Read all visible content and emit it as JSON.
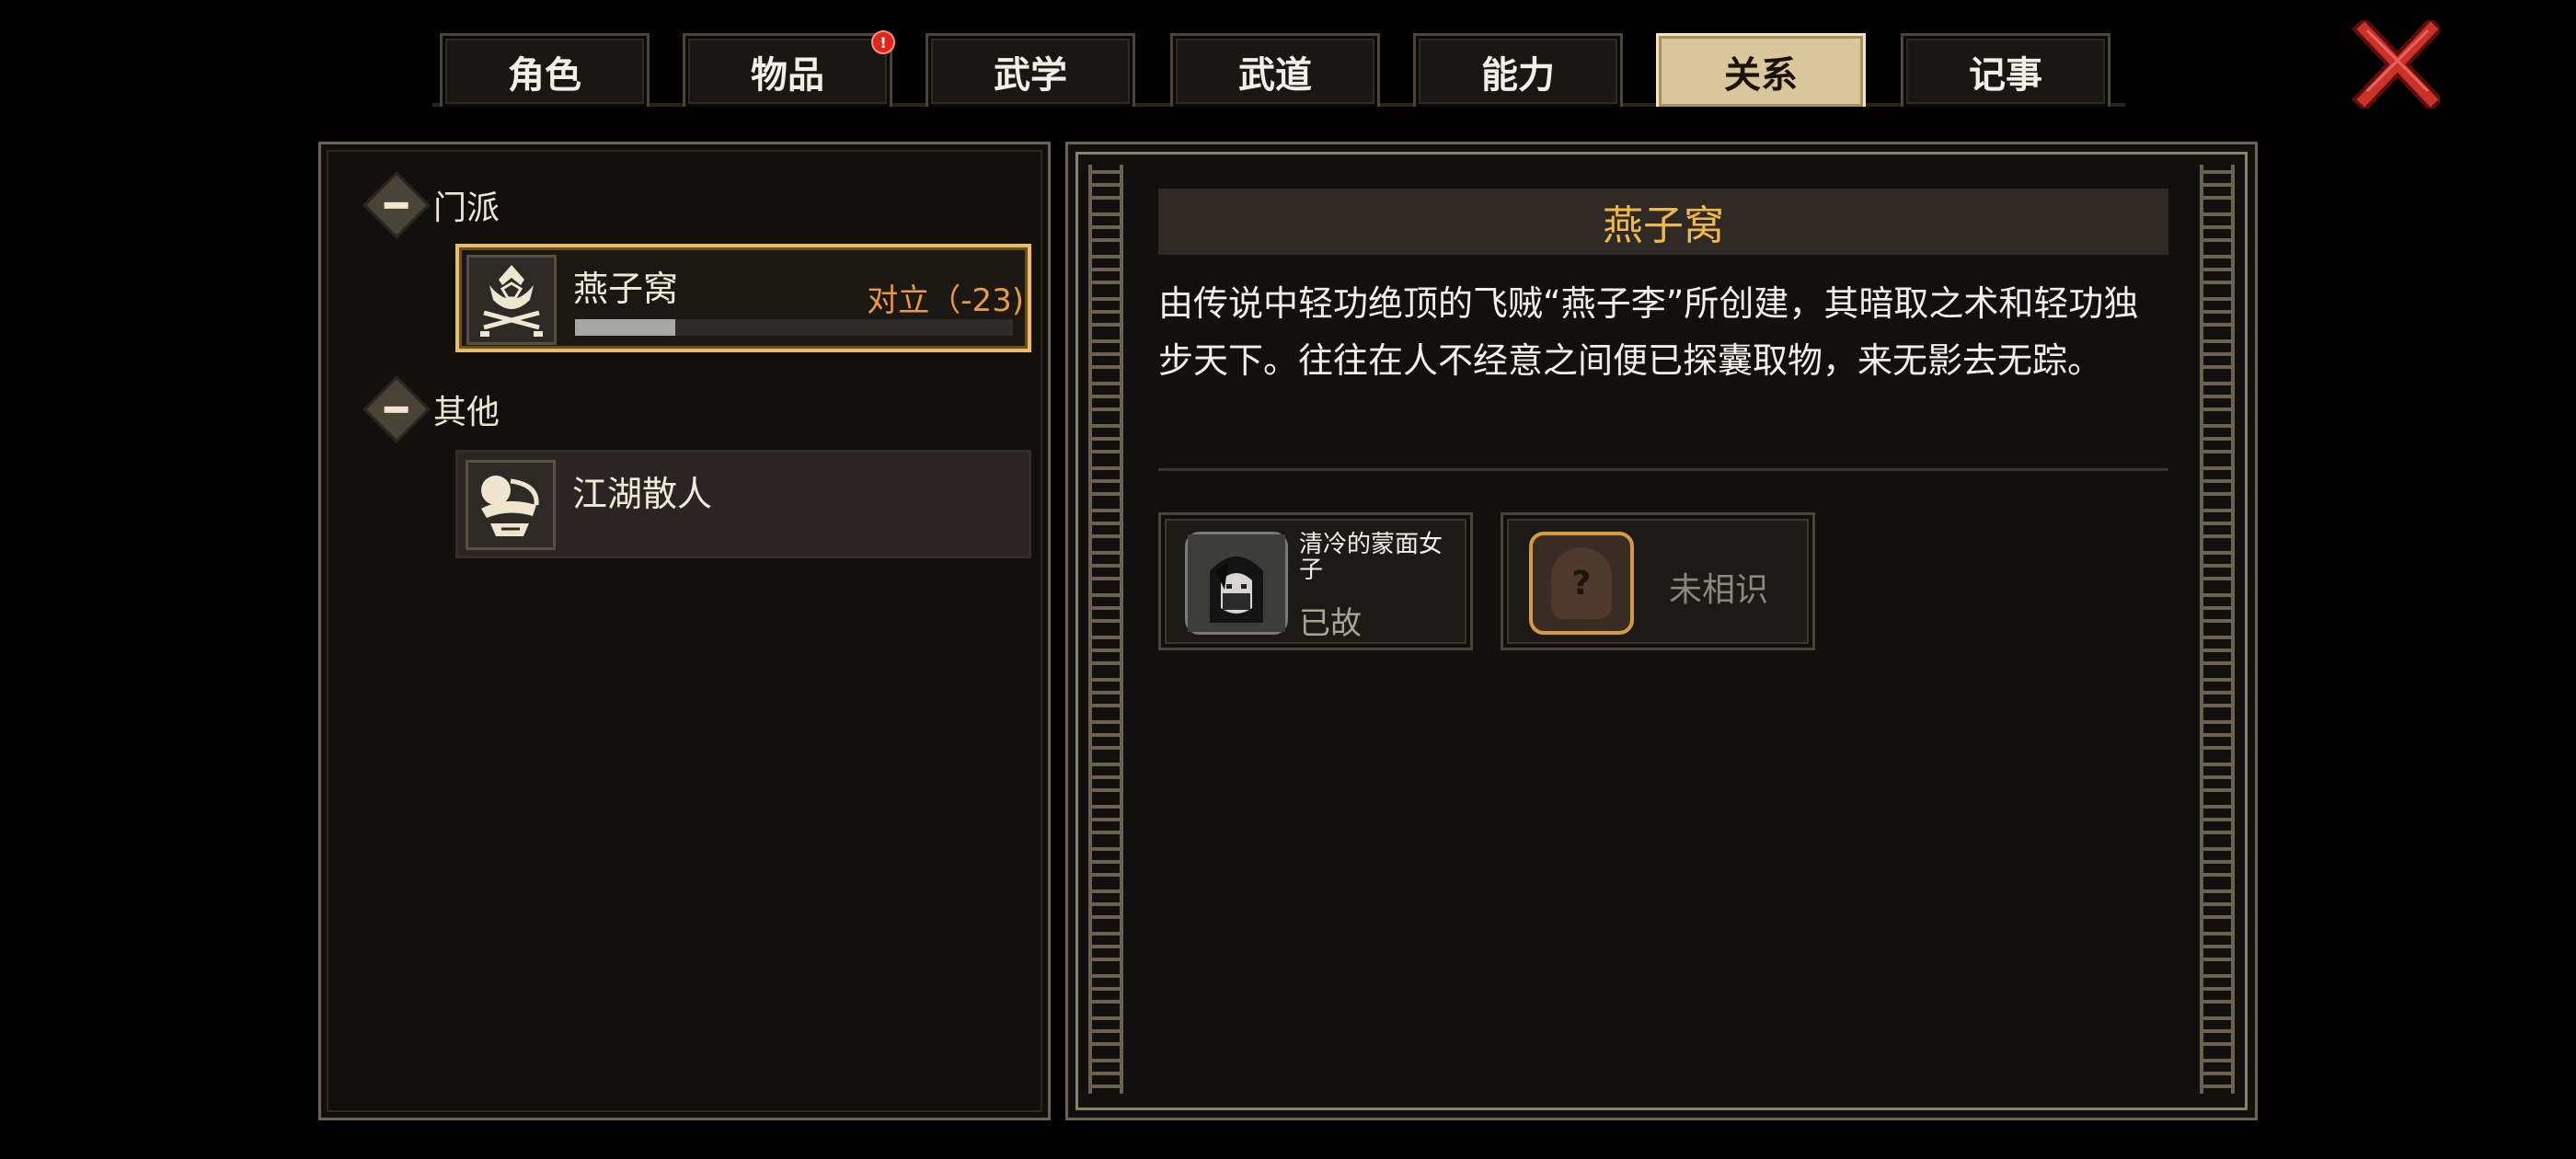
{
  "tabs": [
    {
      "label": "角色",
      "active": false
    },
    {
      "label": "物品",
      "active": false,
      "badge": "!"
    },
    {
      "label": "武学",
      "active": false
    },
    {
      "label": "武道",
      "active": false
    },
    {
      "label": "能力",
      "active": false
    },
    {
      "label": "关系",
      "active": true
    },
    {
      "label": "记事",
      "active": false
    }
  ],
  "close_icon": "close-x-icon",
  "categories": [
    {
      "label": "门派",
      "items": [
        {
          "name": "燕子窝",
          "status": "对立（-23)",
          "relation_fill": 0.23,
          "emblem": "sect-emblem-icon",
          "selected": true
        }
      ]
    },
    {
      "label": "其他",
      "items": [
        {
          "name": "江湖散人",
          "emblem": "wanderer-emblem-icon",
          "selected": false
        }
      ]
    }
  ],
  "detail": {
    "title": "燕子窝",
    "description": "由传说中轻功绝顶的飞贼“燕子李”所创建，其暗取之术和轻功独步天下。往往在人不经意之间便已探囊取物，来无影去无踪。",
    "npcs": [
      {
        "name": "清冷的蒙面女子",
        "status": "已故"
      },
      {
        "name": "",
        "status": "未相识",
        "unknown_mark": "?"
      }
    ]
  },
  "colors": {
    "accent_gold": "#efb84a",
    "status_hostile": "#e79a43",
    "active_tab": "#d9c69b",
    "close_red": "#c8322a"
  }
}
